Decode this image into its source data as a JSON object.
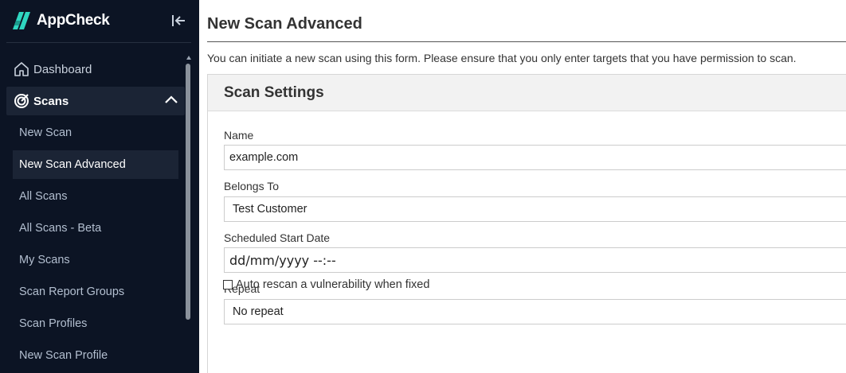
{
  "sidebar": {
    "brand": "AppCheck",
    "items": [
      {
        "label": "Dashboard",
        "icon": "home-icon"
      },
      {
        "label": "Scans",
        "icon": "target-icon",
        "expanded": true
      }
    ],
    "sub_items": [
      {
        "label": "New Scan"
      },
      {
        "label": "New Scan Advanced",
        "active": true
      },
      {
        "label": "All Scans"
      },
      {
        "label": "All Scans - Beta"
      },
      {
        "label": "My Scans"
      },
      {
        "label": "Scan Report Groups"
      },
      {
        "label": "Scan Profiles"
      },
      {
        "label": "New Scan Profile"
      }
    ]
  },
  "main": {
    "title": "New Scan Advanced",
    "intro": "You can initiate a new scan using this form. Please ensure that you only enter targets that you have permission to scan.",
    "panel_title": "Scan Settings",
    "fields": {
      "name": {
        "label": "Name",
        "value": "example.com"
      },
      "belongs_to": {
        "label": "Belongs To",
        "value": "Test Customer"
      },
      "start_date": {
        "label": "Scheduled Start Date",
        "placeholder": "dd/mm/yyyy --:--"
      },
      "repeat": {
        "label": "Repeat",
        "value": "No repeat"
      }
    },
    "auto_rescan": {
      "label": "Auto rescan a vulnerability when fixed",
      "checked": false
    }
  },
  "colors": {
    "sidebar_bg": "#0c1424",
    "sidebar_active_bg": "#1b2435",
    "brand_accent": "#2fd6c1",
    "panel_header_bg": "#f2f2f2"
  }
}
